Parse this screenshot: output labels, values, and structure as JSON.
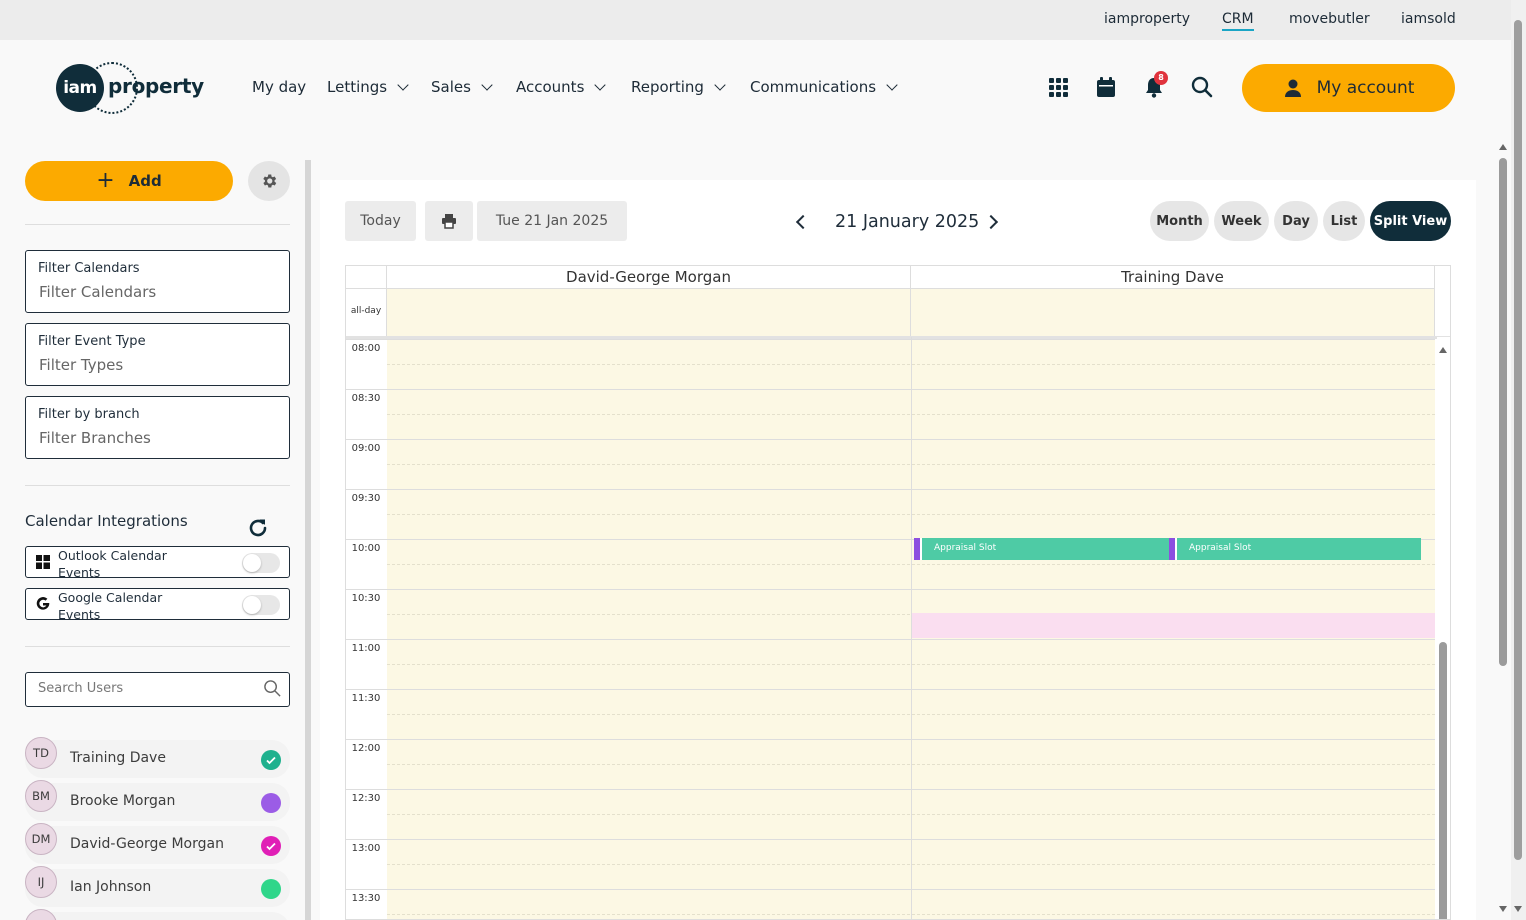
{
  "top_links": [
    {
      "label": "iamproperty"
    },
    {
      "label": "CRM"
    },
    {
      "label": "movebutler"
    },
    {
      "label": "iamsold"
    }
  ],
  "logo": {
    "mark": "iam",
    "word": "property"
  },
  "nav": [
    {
      "label": "My day"
    },
    {
      "label": "Lettings"
    },
    {
      "label": "Sales"
    },
    {
      "label": "Accounts"
    },
    {
      "label": "Reporting"
    },
    {
      "label": "Communications"
    }
  ],
  "notifications": {
    "count": "8"
  },
  "account": {
    "label": "My account"
  },
  "sidebar": {
    "add_label": "Add",
    "filters": [
      {
        "label": "Filter Calendars",
        "placeholder": "Filter Calendars"
      },
      {
        "label": "Filter Event Type",
        "placeholder": "Filter Types"
      },
      {
        "label": "Filter by branch",
        "placeholder": "Filter Branches"
      }
    ],
    "integrations_title": "Calendar Integrations",
    "integrations": [
      {
        "label": "Outlook Calendar Events",
        "enabled": false
      },
      {
        "label": "Google Calendar Events",
        "enabled": false
      }
    ],
    "search_placeholder": "Search Users",
    "users": [
      {
        "initials": "TD",
        "name": "Training Dave",
        "color": "#1fb18e",
        "checked": true
      },
      {
        "initials": "BM",
        "name": "Brooke Morgan",
        "color": "#9b5ce6",
        "checked": false
      },
      {
        "initials": "DM",
        "name": "David-George Morgan",
        "color": "#e01fb6",
        "checked": true
      },
      {
        "initials": "IJ",
        "name": "Ian Johnson",
        "color": "#2fd68a",
        "checked": false
      }
    ]
  },
  "toolbar": {
    "today_label": "Today",
    "date_field": "Tue 21 Jan 2025",
    "title": "21 January 2025",
    "views": [
      {
        "label": "Month",
        "active": false
      },
      {
        "label": "Week",
        "active": false
      },
      {
        "label": "Day",
        "active": false
      },
      {
        "label": "List",
        "active": false
      },
      {
        "label": "Split View",
        "active": true
      }
    ]
  },
  "calendar": {
    "columns": [
      "David-George Morgan",
      "Training Dave"
    ],
    "allday_label": "all-day",
    "times": [
      "08:00",
      "08:30",
      "09:00",
      "09:30",
      "10:00",
      "10:30",
      "11:00",
      "11:30",
      "12:00",
      "12:30",
      "13:00",
      "13:30"
    ],
    "events": [
      {
        "title": "Appraisal Slot",
        "column": "Training Dave",
        "start": "10:00"
      },
      {
        "title": "Appraisal Slot",
        "column": "Training Dave",
        "start": "10:00"
      }
    ]
  }
}
